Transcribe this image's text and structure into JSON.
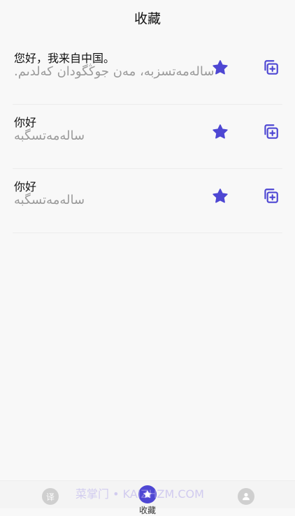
{
  "header": {
    "title": "收藏"
  },
  "favorites": [
    {
      "source": "您好，我来自中国。",
      "target": "سالەمەتسزبە، مەن جوڭگودان كەلدىم."
    },
    {
      "source": "你好",
      "target": "سالەمەتسگبە"
    },
    {
      "source": "你好",
      "target": "سالەمەتسگبە"
    }
  ],
  "tabbar": {
    "translate_icon_text": "译",
    "favorites_label": "收藏",
    "watermark": "菜掌门 • KAIZHZM.COM"
  },
  "colors": {
    "accent": "#4e47d3",
    "muted": "#9a9a9a",
    "background": "#f8f8f8"
  },
  "icons": {
    "favorite": "star-icon",
    "copy": "copy-plus-icon",
    "translate": "translate-icon",
    "profile": "person-icon"
  }
}
